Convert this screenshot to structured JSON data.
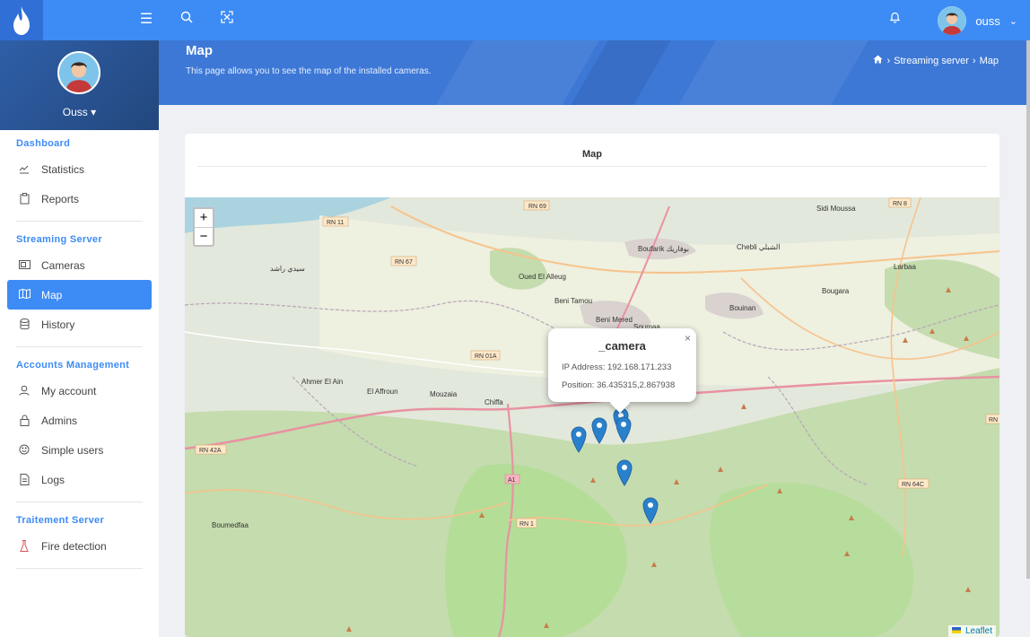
{
  "topbar": {
    "logo": "flame-icon",
    "user_name": "ouss",
    "icons": [
      "menu-icon",
      "search-icon",
      "fullscreen-icon",
      "bell-icon",
      "chevron-down-icon"
    ]
  },
  "sidebar": {
    "user_name": "Ouss",
    "sections": [
      {
        "title": "Dashboard",
        "items": [
          {
            "label": "Statistics",
            "icon": "chart-line-icon"
          },
          {
            "label": "Reports",
            "icon": "clipboard-icon"
          }
        ]
      },
      {
        "title": "Streaming Server",
        "items": [
          {
            "label": "Cameras",
            "icon": "camera-icon"
          },
          {
            "label": "Map",
            "icon": "map-icon",
            "active": true
          },
          {
            "label": "History",
            "icon": "database-icon"
          }
        ]
      },
      {
        "title": "Accounts Management",
        "items": [
          {
            "label": "My account",
            "icon": "user-icon"
          },
          {
            "label": "Admins",
            "icon": "lock-icon"
          },
          {
            "label": "Simple users",
            "icon": "smile-icon"
          },
          {
            "label": "Logs",
            "icon": "file-icon"
          }
        ]
      },
      {
        "title": "Traitement Server",
        "items": [
          {
            "label": "Fire detection",
            "icon": "flask-icon"
          }
        ]
      }
    ]
  },
  "header": {
    "title": "Map",
    "subtitle": "This page allows you to see the map of the installed cameras.",
    "breadcrumb": [
      "Streaming server",
      "Map"
    ]
  },
  "card": {
    "title": "Map"
  },
  "map": {
    "zoom_in": "+",
    "zoom_out": "−",
    "attribution": "Leaflet",
    "popup": {
      "title": "_camera",
      "ip_label": "IP Address: 192.168.171.233",
      "position_label": "Position: 36.435315,2.867938",
      "close": "×"
    },
    "place_labels": [
      "Sidi Moussa",
      "Boufarik بوفاريك",
      "Chebli الشبلي",
      "Oued El Alleug",
      "Beni Tamou",
      "Beni Mered",
      "Larbaa",
      "Bougara",
      "Bouinan",
      "Soumaa",
      "Ahmer El Ain",
      "El Affroun",
      "Mouzaia",
      "Chiffa",
      "Boumedfaa",
      "سيدي راشد"
    ],
    "road_labels": [
      "RN 69",
      "RN 11",
      "RN 67",
      "RN 8",
      "RN 01A",
      "RN 42A",
      "RN 64C",
      "RN 1",
      "A1",
      "RN"
    ]
  }
}
